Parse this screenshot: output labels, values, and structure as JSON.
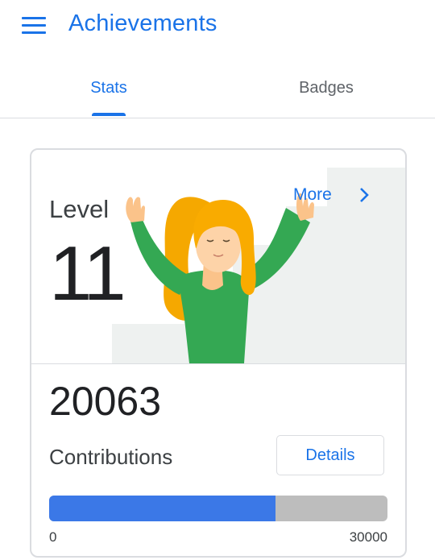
{
  "app_bar": {
    "title": "Achievements",
    "menu_icon": "hamburger-menu-icon"
  },
  "tabs": [
    {
      "label": "Stats",
      "selected": true
    },
    {
      "label": "Badges",
      "selected": false
    }
  ],
  "level_card": {
    "level_label": "Level",
    "level_value": "11",
    "more_label": "More",
    "more_icon": "chevron-right-icon",
    "illustration": "celebrating-woman-illustration"
  },
  "contributions": {
    "count": "20063",
    "label": "Contributions",
    "details_label": "Details",
    "progress": {
      "current": 20063,
      "min_label": "0",
      "max_label": "30000",
      "max": 30000
    }
  },
  "colors": {
    "accent": "#1a73e8",
    "progress_fill": "#3b78e7",
    "progress_track": "#bdbdbd",
    "shirt": "#34a853",
    "hair": "#f9ab00"
  }
}
